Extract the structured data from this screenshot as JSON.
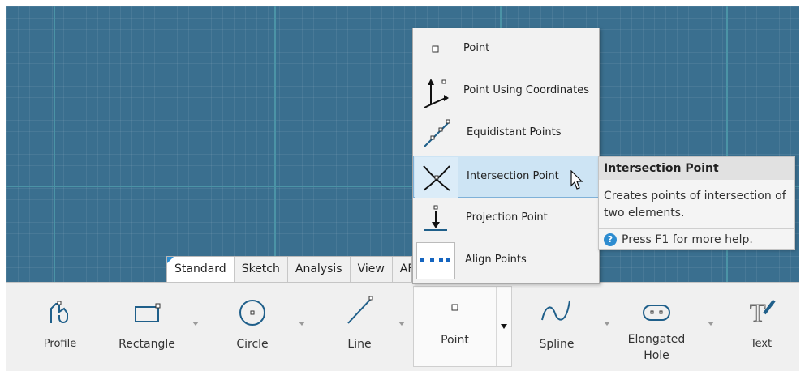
{
  "workbench_tabs": [
    "Standard",
    "Sketch",
    "Analysis",
    "View",
    "AF"
  ],
  "ribbon": {
    "profile": "Profile",
    "rectangle": "Rectangle",
    "circle": "Circle",
    "line": "Line",
    "point": "Point",
    "spline": "Spline",
    "elongated_hole": "Elongated Hole",
    "text": "Text"
  },
  "point_menu": [
    {
      "label": "Point",
      "icon": "point-icon"
    },
    {
      "label": "Point Using Coordinates",
      "icon": "coordinates-axes-icon"
    },
    {
      "label": "Equidistant Points",
      "icon": "equidistant-points-icon"
    },
    {
      "label": "Intersection Point",
      "icon": "intersection-point-icon"
    },
    {
      "label": "Projection Point",
      "icon": "projection-point-icon"
    },
    {
      "label": "Align Points",
      "icon": "align-points-icon"
    }
  ],
  "tooltip": {
    "title": "Intersection Point",
    "body": "Creates points of intersection of two elements.",
    "help": "Press F1 for more help."
  },
  "colors": {
    "viewport": "#3a6f8f",
    "accent": "#2d8cd0",
    "hover": "#cde4f4"
  }
}
